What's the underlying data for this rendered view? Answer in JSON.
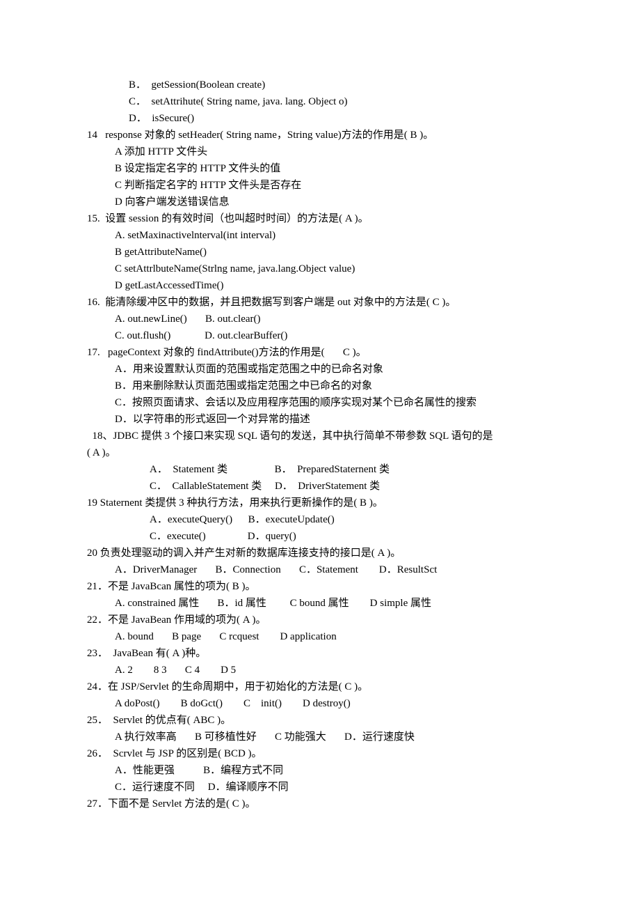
{
  "lines": [
    {
      "cls": "in1",
      "t": "B．  getSession(Boolean create)"
    },
    {
      "cls": "in1",
      "t": "C．  setAttrihute( String name, java. lang. Object o)"
    },
    {
      "cls": "in1",
      "t": "D．  isSecure()"
    },
    {
      "cls": "",
      "t": "14   response 对象的 setHeader( String name，String value)方法的作用是( B )。"
    },
    {
      "cls": "in2",
      "t": "A 添加 HTTP 文件头"
    },
    {
      "cls": "in2",
      "t": "B 设定指定名字的 HTTP 文件头的值"
    },
    {
      "cls": "in2",
      "t": "C 判断指定名字的 HTTP 文件头是否存在"
    },
    {
      "cls": "in2",
      "t": "D 向客户端发送错误信息"
    },
    {
      "cls": "",
      "t": "15.  设置 session 的有效时间（也叫超时时间）的方法是( A )。"
    },
    {
      "cls": "in2",
      "t": "A. setMaxinactivelnterval(int interval)"
    },
    {
      "cls": "in2",
      "t": "B getAttributeName()"
    },
    {
      "cls": "in2",
      "t": "C setAttrlbuteName(Strlng name, java.lang.Object value)"
    },
    {
      "cls": "in2",
      "t": "D getLastAccessedTime()"
    },
    {
      "cls": "",
      "t": "16.  能清除缓冲区中的数据，并且把数据写到客户端是 out 对象中的方法是( C )。"
    },
    {
      "cls": "in2",
      "t": "A. out.newLine()       B. out.clear()"
    },
    {
      "cls": "in2",
      "t": "C. out.flush()             D. out.clearBuffer()"
    },
    {
      "cls": "",
      "t": "17.   pageContext 对象的 findAttribute()方法的作用是(       C )。"
    },
    {
      "cls": "in2",
      "t": "A．用来设置默认页面的范围或指定范围之中的已命名对象"
    },
    {
      "cls": "in2",
      "t": "B．用来删除默认页面范围或指定范围之中已命名的对象"
    },
    {
      "cls": "in2",
      "t": "C．按照页面请求、会话以及应用程序范围的顺序实现对某个已命名属性的搜索"
    },
    {
      "cls": "in2",
      "t": "D．以字符串的形式返回一个对异常的描述"
    },
    {
      "cls": "",
      "t": "  18、JDBC 提供 3 个接口来实现 SQL 语句的发送，其中执行简单不带参数 SQL 语句的是"
    },
    {
      "cls": "",
      "t": "( A )。"
    },
    {
      "cls": "in3",
      "t": "A．  Statement 类                  B．  PreparedStaternent 类"
    },
    {
      "cls": "in3",
      "t": "C．  CallableStatement 类     D．  DriverStatement 类"
    },
    {
      "cls": "",
      "t": "19 Staternent 类提供 3 种执行方法，用来执行更新操作的是( B )。"
    },
    {
      "cls": "in3",
      "t": "A．executeQuery()      B．executeUpdate()"
    },
    {
      "cls": "in3",
      "t": "C．execute()                D．query()"
    },
    {
      "cls": "",
      "t": "20 负责处理驱动的调入并产生对新的数据库连接支持的接口是( A )。"
    },
    {
      "cls": "in2",
      "t": "A．DriverManager       B．Connection       C．Statement        D．ResultSct"
    },
    {
      "cls": "",
      "t": "21．不是 JavaBcan 属性的项为( B )。"
    },
    {
      "cls": "in2",
      "t": "A. constrained 属性       B．id 属性         C bound 属性        D simple 属性"
    },
    {
      "cls": "",
      "t": "22．不是 JavaBean 作用域的项为( A )。"
    },
    {
      "cls": "in2",
      "t": "A. bound       B page       C rcquest        D application"
    },
    {
      "cls": "",
      "t": "23．  JavaBean 有( A )种。"
    },
    {
      "cls": "in2",
      "t": "A. 2        8 3       C 4        D 5"
    },
    {
      "cls": "",
      "t": "24．在 JSP/Servlet 的生命周期中，用于初始化的方法是( C )。"
    },
    {
      "cls": "in2",
      "t": "A doPost()        B doGct()        C    init()        D destroy()"
    },
    {
      "cls": "",
      "t": "25．  Servlet 的优点有( ABC )。"
    },
    {
      "cls": "in2",
      "t": "A 执行效率高       B 可移植性好       C 功能强大       D．运行速度快"
    },
    {
      "cls": "",
      "t": "26．  Scrvlet 与 JSP 的区别是( BCD )。"
    },
    {
      "cls": "in2",
      "t": "A．性能更强           B．编程方式不同"
    },
    {
      "cls": "in2",
      "t": "C．运行速度不同     D．编译顺序不同"
    },
    {
      "cls": "",
      "t": "27．下面不是 Servlet 方法的是( C )。"
    }
  ]
}
